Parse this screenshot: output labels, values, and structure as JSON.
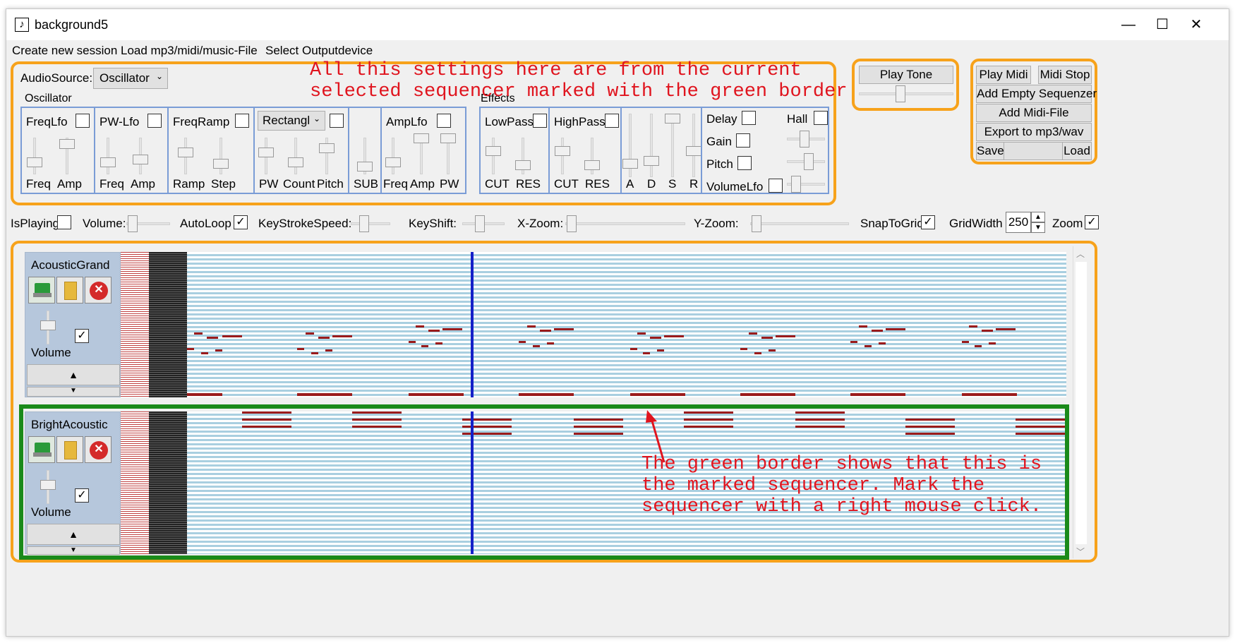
{
  "window": {
    "title": "background5",
    "title_icon": "music-note-icon"
  },
  "menu": [
    "Create new session",
    "Load mp3/midi/music-File",
    "Select Outputdevice"
  ],
  "settings": {
    "audio_source_label": "AudioSource:",
    "audio_source_value": "Oscillator",
    "oscillator_label": "Oscillator",
    "effects_label": "Effects",
    "freqlfo": {
      "title": "FreqLfo",
      "labels": [
        "Freq",
        "Amp"
      ]
    },
    "pwlfo": {
      "title": "PW-Lfo",
      "labels": [
        "Freq",
        "Amp"
      ]
    },
    "freqramp": {
      "title": "FreqRamp",
      "labels": [
        "Ramp",
        "Step"
      ]
    },
    "waveform": {
      "value": "Rectangl",
      "labels": [
        "PW",
        "Count",
        "Pitch"
      ]
    },
    "sub_label": "SUB",
    "amplfo": {
      "title": "AmpLfo",
      "labels": [
        "Freq",
        "Amp",
        "PW"
      ]
    },
    "lowpass": {
      "title": "LowPass",
      "labels": [
        "CUT",
        "RES"
      ]
    },
    "highpass": {
      "title": "HighPass",
      "labels": [
        "CUT",
        "RES"
      ]
    },
    "adsr": [
      "A",
      "D",
      "S",
      "R"
    ],
    "fx": {
      "delay": "Delay",
      "gain": "Gain",
      "pitch": "Pitch",
      "volumelfo": "VolumeLfo",
      "hall": "Hall"
    }
  },
  "play_tone": {
    "label": "Play Tone"
  },
  "actions": {
    "play_midi": "Play Midi",
    "midi_stop": "Midi Stop",
    "add_empty": "Add Empty Sequenzer",
    "add_midi": "Add Midi-File",
    "export": "Export to mp3/wav",
    "save": "Save",
    "load": "Load"
  },
  "toolbar": {
    "isplaying": "IsPlaying",
    "volume": "Volume:",
    "autoloop": "AutoLoop",
    "keystroke": "KeyStrokeSpeed:",
    "keyshift": "KeyShift:",
    "xzoom": "X-Zoom:",
    "yzoom": "Y-Zoom:",
    "snap": "SnapToGrid",
    "gridwidth": "GridWidth",
    "gridwidth_value": "250",
    "zoom": "Zoom",
    "autoloop_checked": true,
    "snap_checked": true,
    "zoom_checked": true
  },
  "sequencers": [
    {
      "name": "AcousticGrand",
      "volume_label": "Volume",
      "checked": true,
      "marked": false
    },
    {
      "name": "BrightAcoustic",
      "volume_label": "Volume",
      "checked": true,
      "marked": true
    }
  ],
  "annotations": {
    "top": "All this settings here are from the current\nselected sequencer marked with the green border.",
    "bottom": "The green border shows that this is\nthe marked sequencer. Mark the\nsequencer with a right mouse click."
  },
  "colors": {
    "orange_border": "#f7a21b",
    "green_border": "#1a8a1a",
    "annotation_red": "#e0141e",
    "playhead": "#1420c8",
    "note": "#9b1b1b"
  }
}
